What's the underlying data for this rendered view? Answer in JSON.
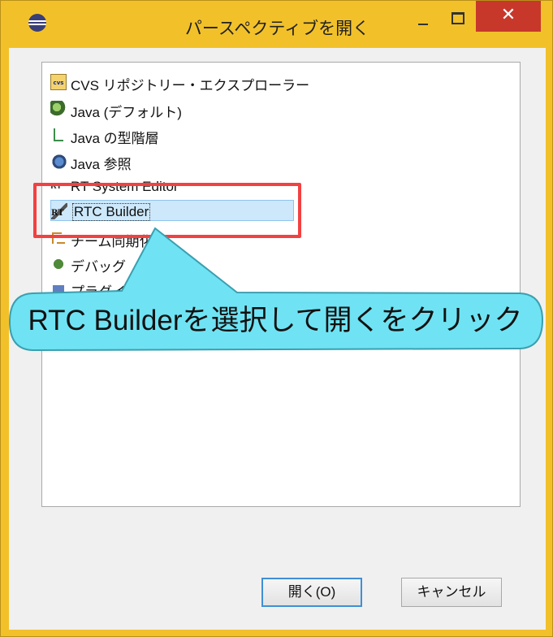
{
  "window": {
    "title": "パースペクティブを開く",
    "close_glyph": "✕",
    "frame_color": "#f2c12a",
    "close_color": "#c7382b"
  },
  "list": {
    "items": [
      {
        "icon": "cvs-repository-icon",
        "icon_text": "cvs",
        "label": "CVS リポジトリー・エクスプローラー"
      },
      {
        "icon": "java-perspective-icon",
        "label": "Java (デフォルト)"
      },
      {
        "icon": "type-hierarchy-icon",
        "label": "Java の型階層"
      },
      {
        "icon": "java-browse-icon",
        "label": "Java 参照"
      },
      {
        "icon": "rt-system-editor-icon",
        "icon_text": "RT",
        "label": "RT System Editor"
      },
      {
        "icon": "rtc-builder-icon",
        "icon_text": "RT",
        "label": "RTC Builder",
        "selected": true
      },
      {
        "icon": "team-sync-icon",
        "label": "チーム同期化"
      },
      {
        "icon": "debug-icon",
        "label": "デバッグ"
      },
      {
        "icon": "plugin-icon",
        "label": "プラグイン開発"
      }
    ],
    "selection_color": "#cde8fb"
  },
  "buttons": {
    "open_label": "開く(O)",
    "cancel_label": "キャンセル"
  },
  "annotation": {
    "callout_text": "RTC Builderを選択して開くをクリック",
    "callout_color": "#6fe3f3",
    "highlight_color": "#f24141"
  }
}
